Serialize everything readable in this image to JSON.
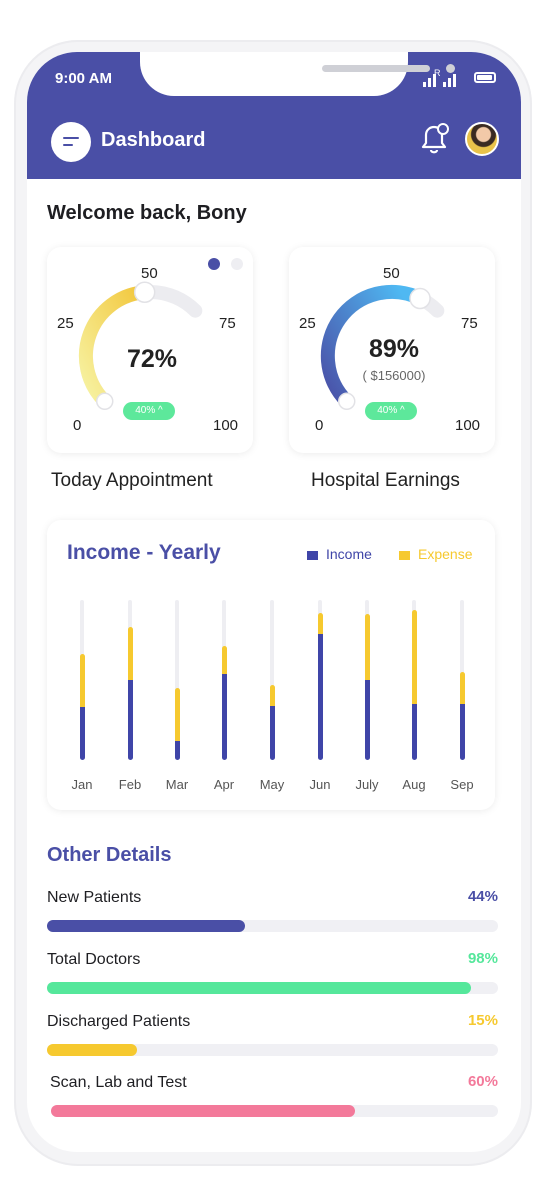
{
  "status_bar": {
    "time": "9:00 AM",
    "signal_mark": "R"
  },
  "header": {
    "title": "Dashboard"
  },
  "welcome": "Welcome back, Bony",
  "gauges": [
    {
      "label": "Today Appointment",
      "value_text": "72%",
      "sub_text": "",
      "badge": "40% ^",
      "ticks": [
        "0",
        "25",
        "50",
        "75",
        "100"
      ],
      "value": 72,
      "color_start": "#f5f07a",
      "color_end": "#f2c73a"
    },
    {
      "label": "Hospital Earnings",
      "value_text": "89%",
      "sub_text": "( $156000)",
      "badge": "40% ^",
      "ticks": [
        "0",
        "25",
        "50",
        "75",
        "100"
      ],
      "value": 89,
      "color_start": "#4a4fa6",
      "color_end": "#4fb3f0"
    }
  ],
  "carousel": {
    "active_index": 0,
    "count": 2
  },
  "income": {
    "title": "Income - Yearly",
    "legend": [
      {
        "name": "Income",
        "color": "#3f45a8"
      },
      {
        "name": "Expense",
        "color": "#f6c92f"
      }
    ]
  },
  "chart_data": {
    "type": "bar",
    "stacked": true,
    "categories": [
      "Jan",
      "Feb",
      "Mar",
      "Apr",
      "May",
      "Jun",
      "July",
      "Aug",
      "Sep"
    ],
    "series": [
      {
        "name": "Income",
        "values": [
          33,
          50,
          12,
          54,
          34,
          79,
          50,
          35,
          35
        ]
      },
      {
        "name": "Expense",
        "values": [
          33,
          33,
          33,
          17,
          13,
          13,
          41,
          59,
          20
        ]
      }
    ],
    "ylim": [
      0,
      100
    ],
    "colors": {
      "Income": "#3f45a8",
      "Expense": "#f6c92f",
      "track": "#eeeef2"
    }
  },
  "other_details": {
    "title": "Other Details",
    "rows": [
      {
        "label": "New Patients",
        "percent_text": "44%",
        "percent": 44,
        "color": "#4a4fa6"
      },
      {
        "label": "Total Doctors",
        "percent_text": "98%",
        "percent": 94,
        "color": "#55e79b"
      },
      {
        "label": "Discharged Patients",
        "percent_text": "15%",
        "percent": 20,
        "color": "#f6c92f"
      },
      {
        "label": "Scan, Lab and Test",
        "percent_text": "60%",
        "percent": 68,
        "color": "#f3799a"
      }
    ]
  }
}
